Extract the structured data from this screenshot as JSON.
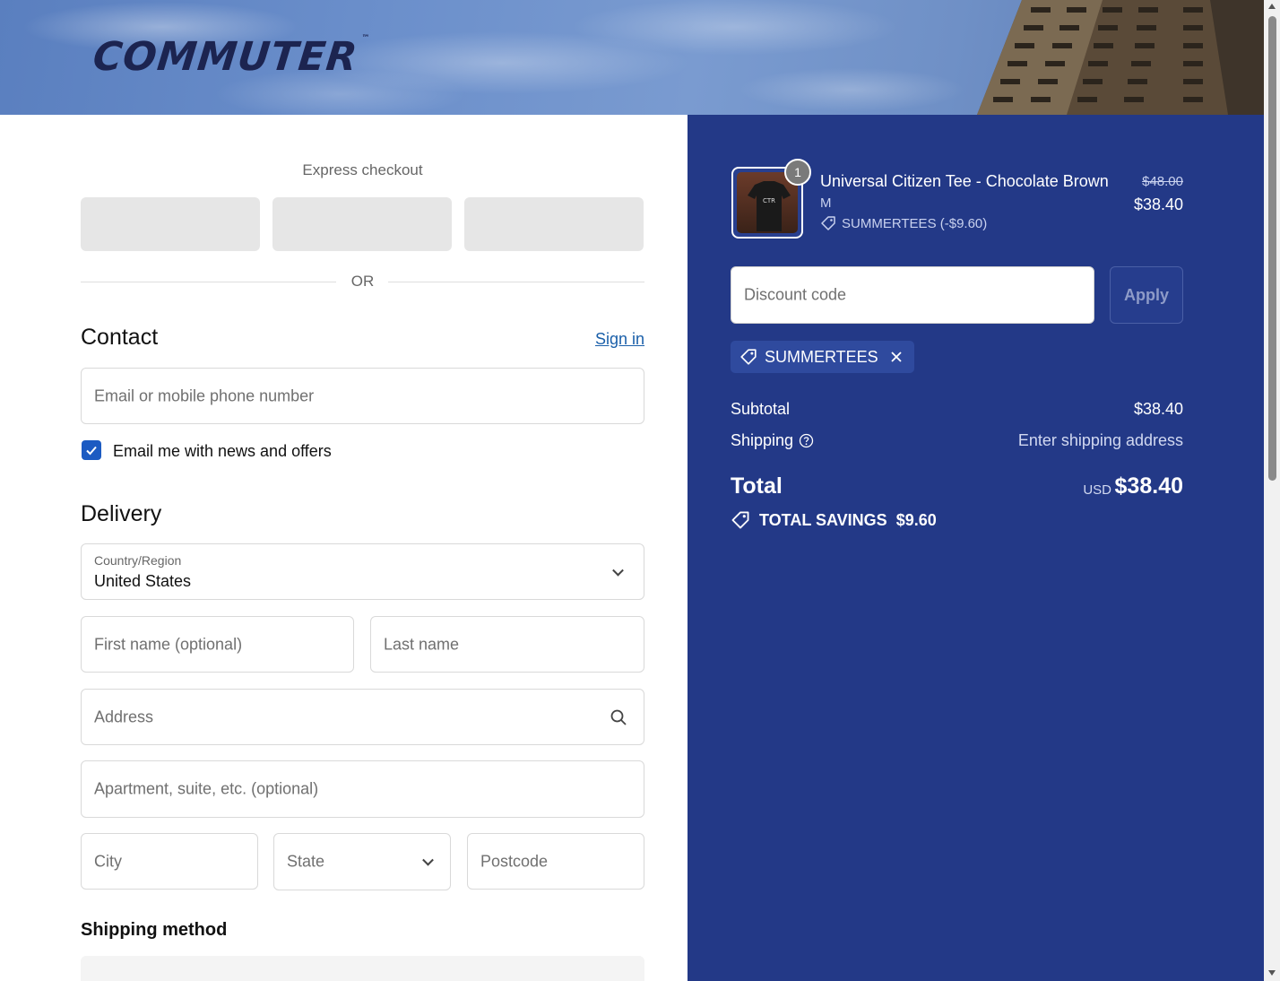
{
  "header": {
    "logo_text": "COMMUTER",
    "logo_mark": "™"
  },
  "express": {
    "title": "Express checkout",
    "or_label": "OR"
  },
  "contact": {
    "heading": "Contact",
    "sign_in": "Sign in",
    "email_placeholder": "Email or mobile phone number",
    "news_opt_in_label": "Email me with news and offers",
    "news_opt_in_checked": true
  },
  "delivery": {
    "heading": "Delivery",
    "country_label": "Country/Region",
    "country_value": "United States",
    "first_name_placeholder": "First name (optional)",
    "last_name_placeholder": "Last name",
    "address_placeholder": "Address",
    "apartment_placeholder": "Apartment, suite, etc. (optional)",
    "city_placeholder": "City",
    "state_placeholder": "State",
    "postcode_placeholder": "Postcode"
  },
  "shipping_method": {
    "heading": "Shipping method"
  },
  "order": {
    "item": {
      "name": "Universal Citizen Tee - Chocolate Brown",
      "variant": "M",
      "discount_tag": "SUMMERTEES (-$9.60)",
      "quantity": "1",
      "price_original": "$48.00",
      "price_now": "$38.40"
    },
    "discount_placeholder": "Discount code",
    "apply_label": "Apply",
    "applied_code": "SUMMERTEES",
    "subtotal_label": "Subtotal",
    "subtotal_value": "$38.40",
    "shipping_label": "Shipping",
    "shipping_value": "Enter shipping address",
    "total_label": "Total",
    "currency": "USD",
    "total_value": "$38.40",
    "savings_label": "TOTAL SAVINGS",
    "savings_value": "$9.60"
  },
  "colors": {
    "summary_bg": "#233987",
    "link": "#1a5fa9",
    "checkbox": "#1c5bc2",
    "logo": "#1c2450"
  }
}
